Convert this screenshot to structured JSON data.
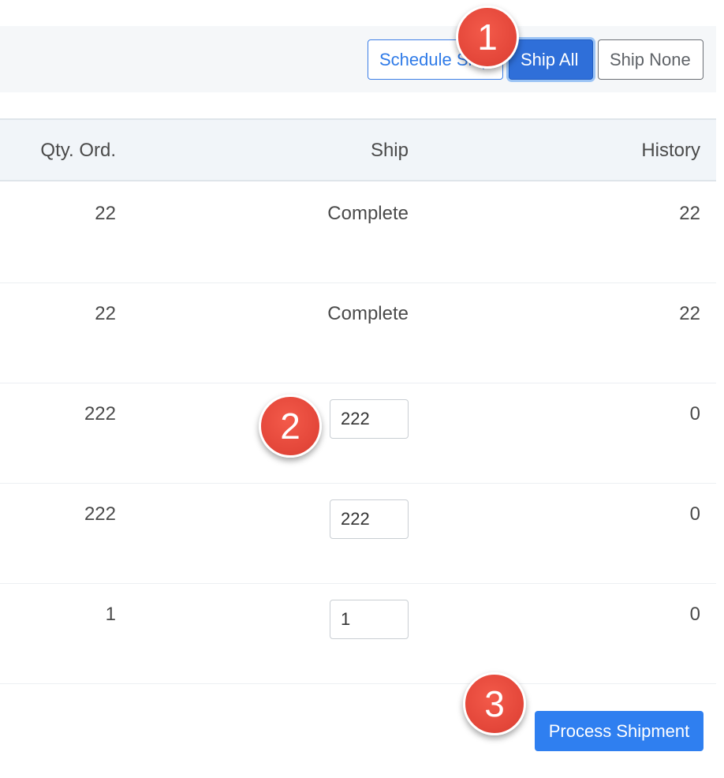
{
  "toolbar": {
    "schedule_label": "Schedule Shipment",
    "ship_all_label": "Ship All",
    "ship_none_label": "Ship None"
  },
  "table": {
    "headers": {
      "qty_ordered": "Qty. Ord.",
      "ship": "Ship",
      "history": "History"
    },
    "rows": [
      {
        "qty_ordered": "22",
        "ship_status": "Complete",
        "history": "22"
      },
      {
        "qty_ordered": "22",
        "ship_status": "Complete",
        "history": "22"
      },
      {
        "qty_ordered": "222",
        "ship_value": "222",
        "history": "0"
      },
      {
        "qty_ordered": "222",
        "ship_value": "222",
        "history": "0"
      },
      {
        "qty_ordered": "1",
        "ship_value": "1",
        "history": "0"
      }
    ]
  },
  "footer": {
    "process_label": "Process Shipment"
  },
  "markers": {
    "step1": "1",
    "step2": "2",
    "step3": "3"
  },
  "colors": {
    "primary": "#2f7ff0",
    "ship_all_active": "#2f6fd9",
    "marker_red": "#e4473a",
    "toolbar_bg": "#f5f7f9",
    "header_bg": "#f1f5f9"
  }
}
